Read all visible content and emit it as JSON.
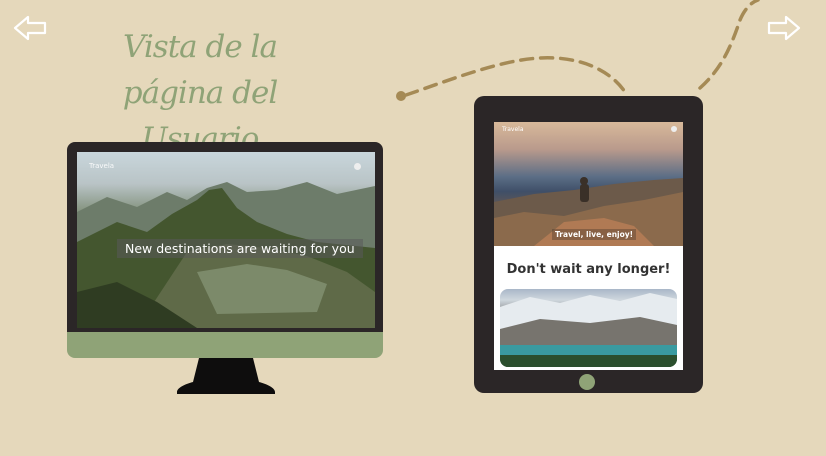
{
  "nav": {
    "prev_label": "Previous slide",
    "next_label": "Next slide"
  },
  "title": {
    "line1": "Vista de la página del",
    "line2": "Usuario"
  },
  "desktop": {
    "logo": "Travela",
    "hero_text": "New destinations are waiting for you"
  },
  "tablet": {
    "logo": "Travela",
    "hero_caption": "Travel, live, enjoy!",
    "heading": "Don't wait any longer!"
  },
  "colors": {
    "background": "#e5d8bb",
    "accent_green": "#8fa377",
    "device_frame": "#2b2627",
    "dashed_path": "#a58a55"
  }
}
